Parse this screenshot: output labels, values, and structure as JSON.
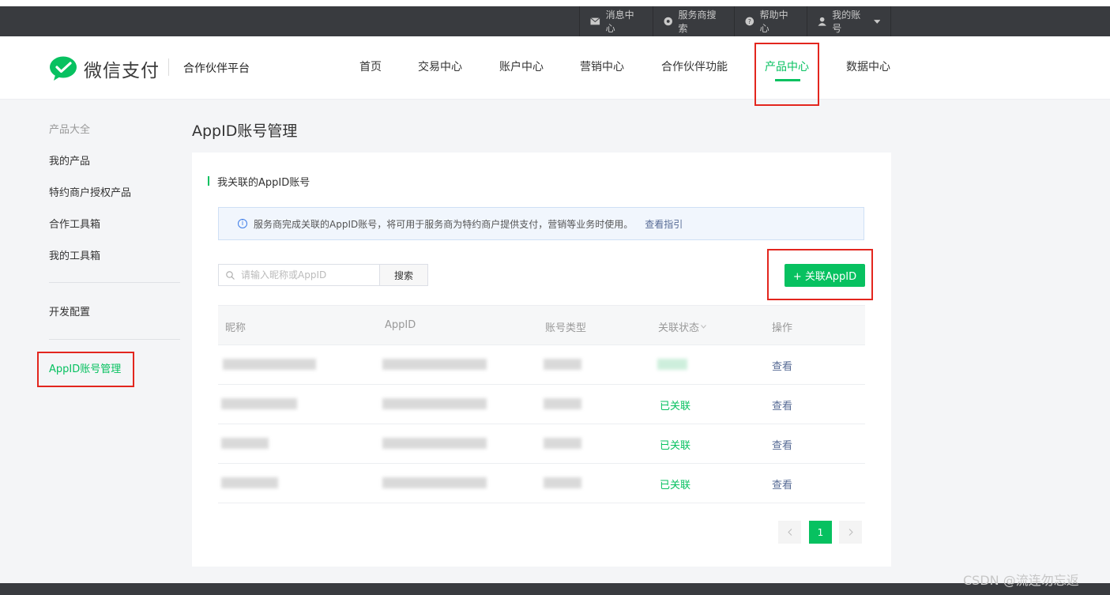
{
  "topbar": {
    "messages": "消息中心",
    "provider_search": "服务商搜索",
    "help": "帮助中心",
    "account": "我的账号"
  },
  "brand": {
    "name": "微信支付",
    "platform": "合作伙伴平台"
  },
  "nav": [
    "首页",
    "交易中心",
    "账户中心",
    "营销中心",
    "合作伙伴功能",
    "产品中心",
    "数据中心"
  ],
  "nav_active": "产品中心",
  "sidebar": {
    "items": [
      "产品大全",
      "我的产品",
      "特约商户授权产品",
      "合作工具箱",
      "我的工具箱",
      "开发配置",
      "AppID账号管理"
    ]
  },
  "page": {
    "title": "AppID账号管理",
    "section_title": "我关联的AppID账号",
    "notice": "服务商完成关联的AppID账号，将可用于服务商为特约商户提供支付，营销等业务时使用。",
    "notice_link": "查看指引",
    "search_placeholder": "请输入昵称或AppID",
    "search_button": "搜索",
    "add_button": "+ 关联AppID"
  },
  "table": {
    "headers": [
      "昵称",
      "AppID",
      "账号类型",
      "关联状态",
      "操作"
    ],
    "rows": [
      {
        "status": "",
        "action": "查看"
      },
      {
        "status": "已关联",
        "action": "查看"
      },
      {
        "status": "已关联",
        "action": "查看"
      },
      {
        "status": "已关联",
        "action": "查看"
      }
    ]
  },
  "pagination": {
    "current": "1"
  },
  "watermark": "CSDN @流连勿忘返",
  "colors": {
    "accent": "#07c160",
    "highlight": "#e3261e",
    "topbar": "#393b3f",
    "link": "#576b95"
  }
}
